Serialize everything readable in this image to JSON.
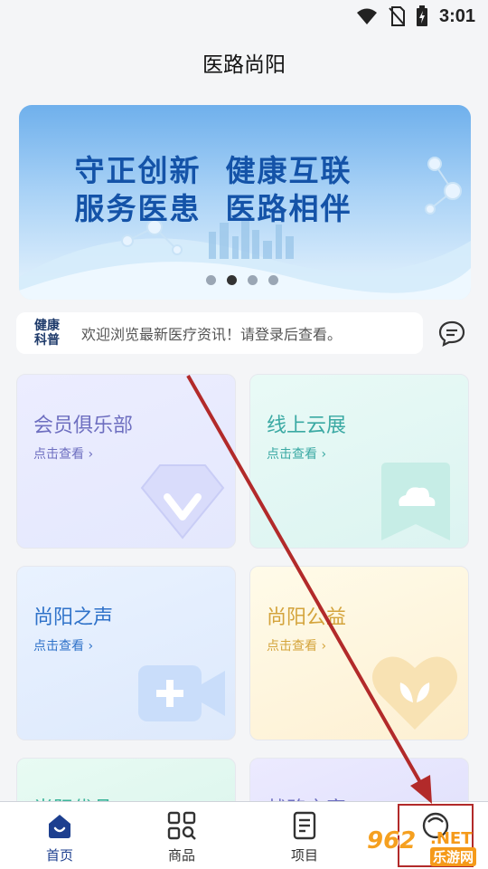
{
  "status_bar": {
    "time": "3:01"
  },
  "header": {
    "title": "医路尚阳"
  },
  "banner": {
    "line1": "守正创新  健康互联",
    "line2": "服务医患  医路相伴",
    "page_count": 4,
    "active_index": 1
  },
  "notice": {
    "tag_line1": "健康",
    "tag_line2": "科普",
    "text": "欢迎浏览最新医疗资讯！请登录后查看。"
  },
  "cards": [
    {
      "title": "会员俱乐部",
      "sub": "点击查看",
      "icon": "diamond-icon"
    },
    {
      "title": "线上云展",
      "sub": "点击查看",
      "icon": "cloud-icon"
    },
    {
      "title": "尚阳之声",
      "sub": "点击查看",
      "icon": "video-icon"
    },
    {
      "title": "尚阳公益",
      "sub": "点击查看",
      "icon": "heart-leaf-icon"
    },
    {
      "title": "尚阳优品",
      "icon": ""
    },
    {
      "title": "战略之窗",
      "icon": ""
    }
  ],
  "tabbar": {
    "items": [
      {
        "label": "首页",
        "icon": "home-icon",
        "active": true
      },
      {
        "label": "商品",
        "icon": "grid-search-icon",
        "active": false
      },
      {
        "label": "项目",
        "icon": "document-icon",
        "active": false
      },
      {
        "label": "",
        "icon": "profile-icon",
        "active": false
      }
    ]
  },
  "watermark": {
    "number": "962",
    "domain": ".NET",
    "site": "乐游网"
  },
  "colors": {
    "accent": "#1d3f8f",
    "annotation": "#b22a2a"
  }
}
